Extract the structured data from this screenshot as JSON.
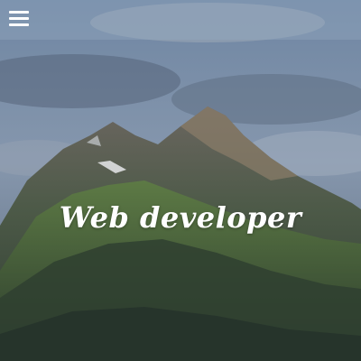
{
  "hero": {
    "headline": "Web developer",
    "background": "mountain-landscape"
  },
  "navbar": {
    "menu_icon": "hamburger-menu-icon"
  },
  "colors": {
    "navbar_overlay": "#96aac3",
    "headline_text": "#ffffff"
  }
}
